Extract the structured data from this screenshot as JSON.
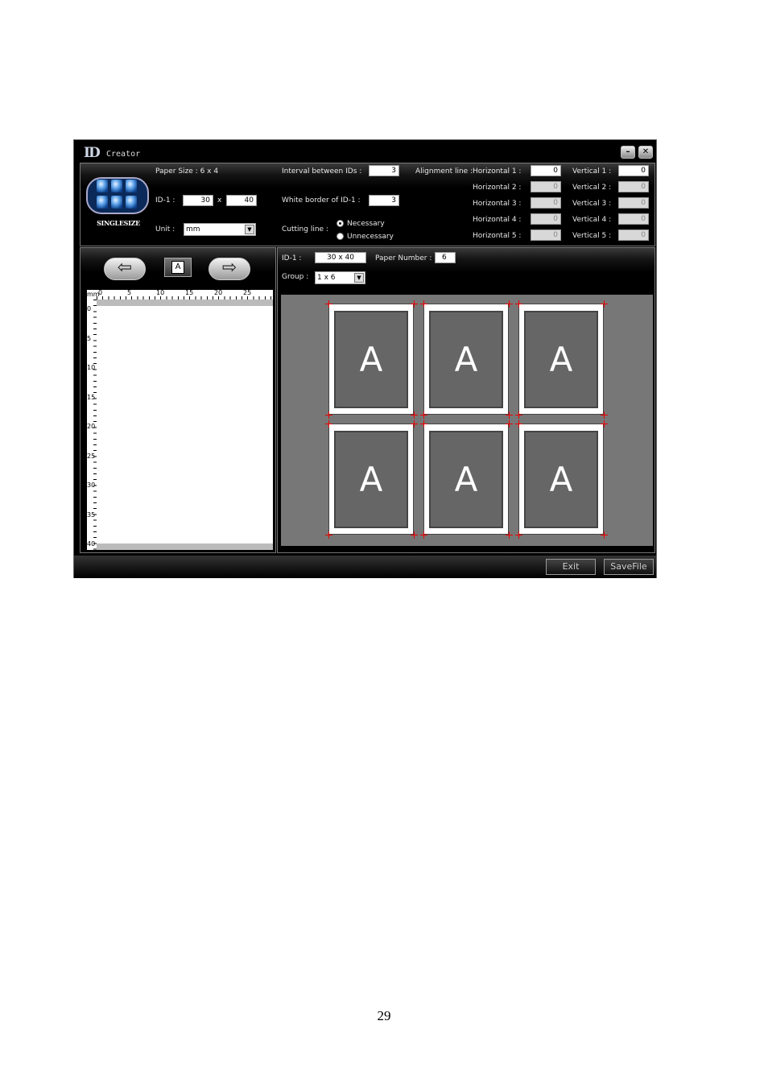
{
  "window": {
    "logo": "ID",
    "title": "Creator",
    "minimize_label": "–",
    "close_label": "✕"
  },
  "settings": {
    "badge_label": "SINGLESIZE",
    "paper_size": "Paper Size : 6 x 4",
    "id_label": "ID-1 :",
    "id_width": "30",
    "id_x": "x",
    "id_height": "40",
    "unit_label": "Unit :",
    "unit_value": "mm",
    "interval_label": "Interval between IDs :",
    "interval_value": "3",
    "white_border_label": "White border of ID-1 :",
    "white_border_value": "3",
    "cutting_label": "Cutting line :",
    "cutting_options": [
      "Necessary",
      "Unnecessary"
    ],
    "alignment_label": "Alignment line :",
    "horizontal": [
      {
        "label": "Horizontal 1 :",
        "value": "0"
      },
      {
        "label": "Horizontal 2 :",
        "value": "0"
      },
      {
        "label": "Horizontal 3 :",
        "value": "0"
      },
      {
        "label": "Horizontal 4 :",
        "value": "0"
      },
      {
        "label": "Horizontal 5 :",
        "value": "0"
      }
    ],
    "vertical": [
      {
        "label": "Vertical 1 :",
        "value": "0"
      },
      {
        "label": "Vertical 2 :",
        "value": "0"
      },
      {
        "label": "Vertical 3 :",
        "value": "0"
      },
      {
        "label": "Vertical 4 :",
        "value": "0"
      },
      {
        "label": "Vertical 5 :",
        "value": "0"
      }
    ]
  },
  "editor": {
    "back_glyph": "⇦",
    "forward_glyph": "⇨",
    "current_label": "A",
    "ruler_unit": "mm",
    "ruler_h_ticks": [
      "0",
      "5",
      "10",
      "15",
      "20",
      "25"
    ],
    "ruler_v_ticks": [
      "0",
      "5",
      "10",
      "15",
      "20",
      "25",
      "30",
      "35",
      "40"
    ]
  },
  "layout": {
    "id_label": "ID-1 :",
    "id_value": "30 x 40",
    "paper_number_label": "Paper Number :",
    "paper_number_value": "6",
    "group_label": "Group :",
    "group_value": "1 x 6",
    "cards": [
      "A",
      "A",
      "A",
      "A",
      "A",
      "A"
    ]
  },
  "footer": {
    "exit_label": "Exit",
    "save_label": "SaveFile"
  },
  "page_number": "29"
}
